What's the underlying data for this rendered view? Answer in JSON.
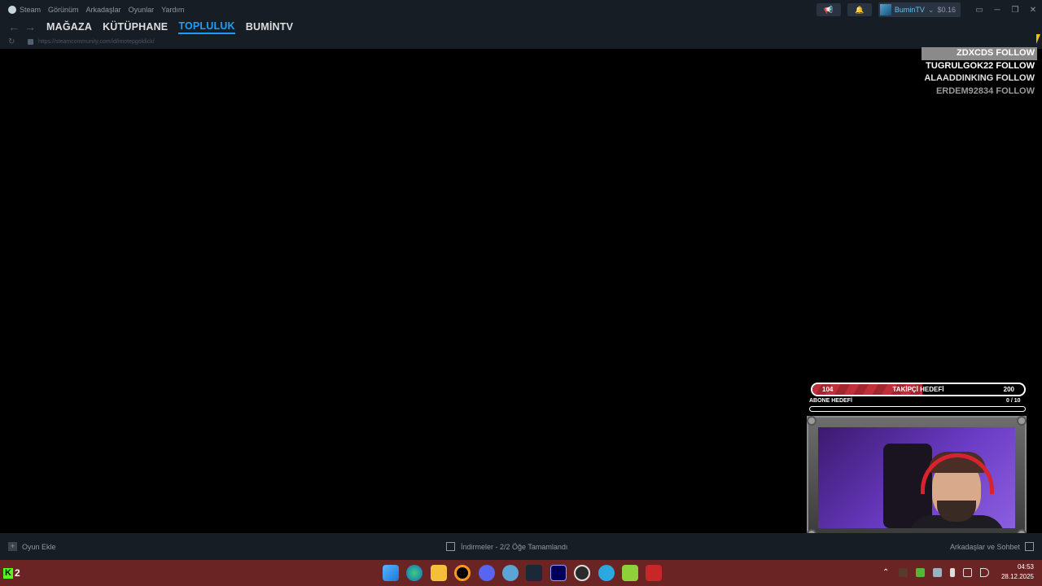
{
  "menubar": {
    "items": [
      "Steam",
      "Görünüm",
      "Arkadaşlar",
      "Oyunlar",
      "Yardım"
    ],
    "username": "BuminTV",
    "user_dropdown": "⌄",
    "balance": "$0.16",
    "megaphone_glyph": "📢",
    "bell_glyph": "🔔"
  },
  "window_controls": {
    "display": "▭",
    "minimize": "─",
    "restore": "❐",
    "close": "✕"
  },
  "nav": {
    "back": "←",
    "forward": "→",
    "tabs": [
      "MAĞAZA",
      "KÜTÜPHANE",
      "TOPLULUK",
      "BUMİNTV"
    ],
    "active_tab": "TOPLULUK"
  },
  "urlbar": {
    "reload": "↻",
    "url": "https://steamcommunity.com/id/imotepgoldick/"
  },
  "follows": [
    {
      "name": "ZDXCDS",
      "action": "FOLLOW"
    },
    {
      "name": "TUGRULGOK22",
      "action": "FOLLOW"
    },
    {
      "name": "ALAADDINKING",
      "action": "FOLLOW"
    },
    {
      "name": "ERDEM92834",
      "action": "FOLLOW"
    }
  ],
  "follower_goal": {
    "current": "104",
    "title": "TAKİPÇİ HEDEFİ",
    "target": "200",
    "progress": 0.52
  },
  "sub_goal": {
    "label": "ABONE HEDEFİ",
    "count": "0  / 10",
    "progress": 0
  },
  "bottombar": {
    "add_game": "Oyun Ekle",
    "add_glyph": "+",
    "downloads": "İndirmeler - 2/2 Öğe Tamamlandı",
    "friends": "Arkadaşlar ve Sohbet"
  },
  "taskbar": {
    "kick_logo": "K",
    "kick_viewers": "2",
    "apps": [
      "windows-start",
      "edge",
      "file-explorer",
      "origin",
      "discord",
      "sky-app",
      "steam",
      "premiere-pro",
      "obs",
      "chromium-app",
      "notepad-a",
      "stream-app"
    ],
    "tray_chevron": "⌃",
    "time": "04:53",
    "date": "28.12.2025"
  },
  "colors": {
    "steam_bg": "#171d25",
    "steam_accent": "#1a9fff",
    "taskbar": "#6b2424",
    "goal_fill": "#c0303a",
    "kick_green": "#53fc18"
  }
}
